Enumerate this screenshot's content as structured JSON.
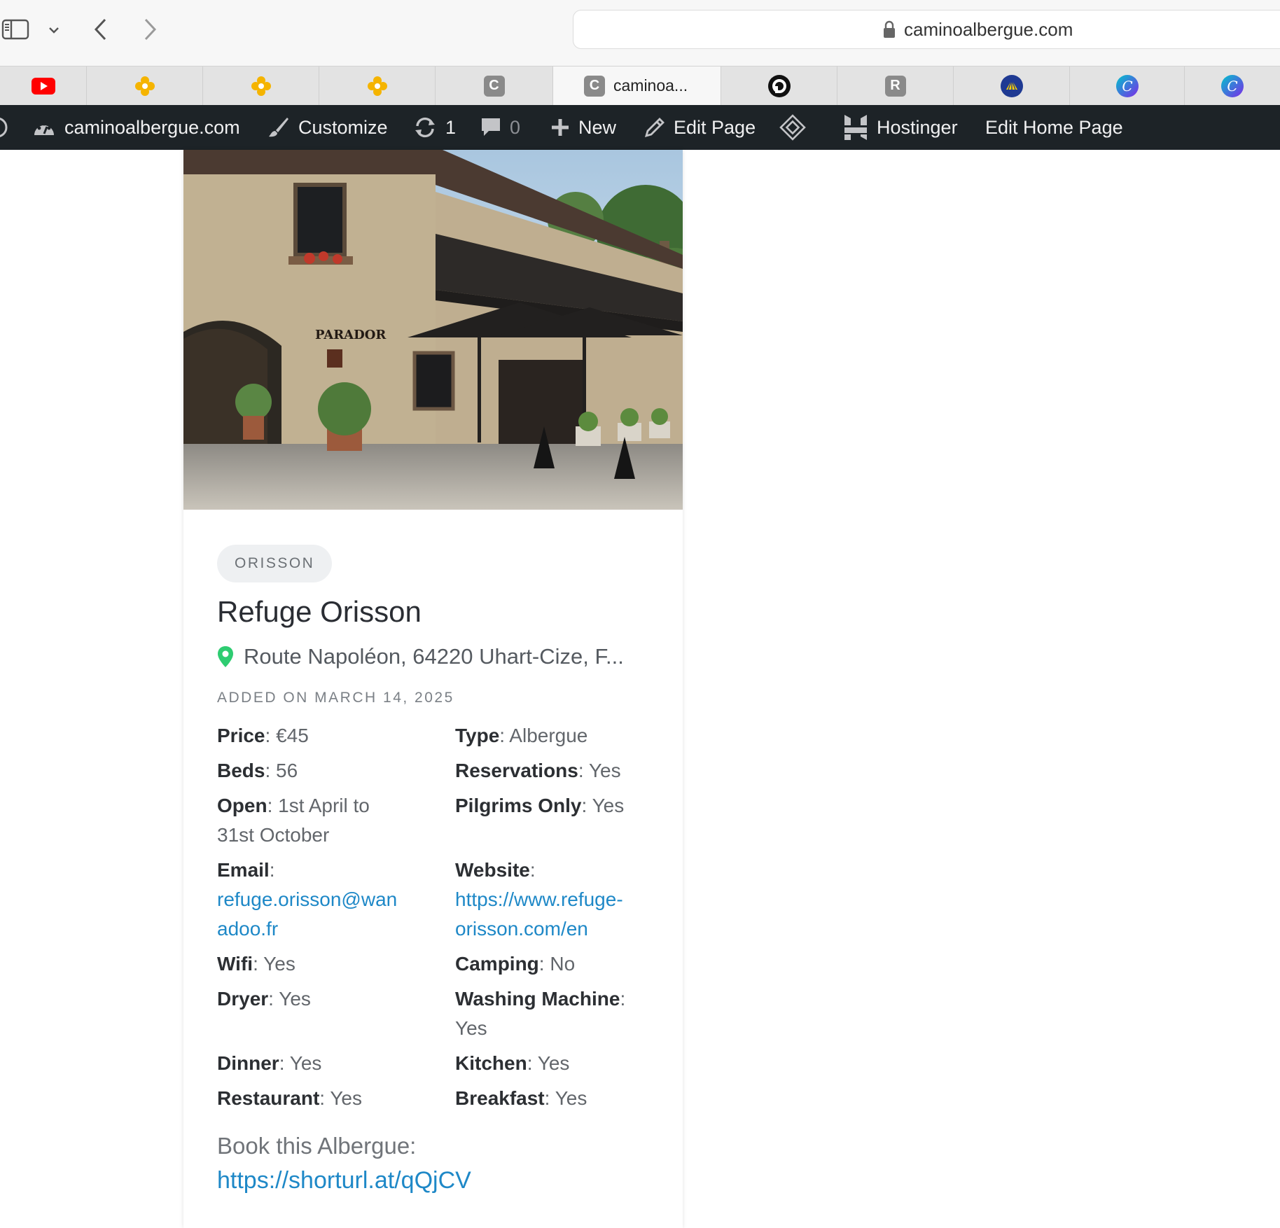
{
  "browser": {
    "url": "caminoalbergue.com",
    "tabs": [
      {
        "icon": "youtube-icon"
      },
      {
        "icon": "yellow-flower-icon"
      },
      {
        "icon": "yellow-flower-icon"
      },
      {
        "icon": "yellow-flower-icon"
      },
      {
        "icon": "c-icon",
        "letter": "C"
      },
      {
        "icon": "c-icon",
        "letter": "C",
        "title": "caminoa...",
        "active": true
      },
      {
        "icon": "circle-logo-icon"
      },
      {
        "icon": "r-icon",
        "letter": "R"
      },
      {
        "icon": "scallop-shell-icon"
      },
      {
        "icon": "canva-icon",
        "letter": "C"
      },
      {
        "icon": "canva-icon",
        "letter": "C"
      }
    ]
  },
  "adminbar": {
    "site": "caminoalbergue.com",
    "customize": "Customize",
    "updates_count": "1",
    "comments_count": "0",
    "new": "New",
    "edit_page": "Edit Page",
    "hostinger": "Hostinger",
    "edit_home": "Edit Home Page"
  },
  "listing": {
    "tag": "ORISSON",
    "title": "Refuge Orisson",
    "address": "Route Napoléon, 64220 Uhart-Cize, F...",
    "added": "ADDED ON MARCH 14, 2025",
    "photo_sign": "PARADOR",
    "fields": {
      "price_label": "Price",
      "price": "€45",
      "type_label": "Type",
      "type": "Albergue",
      "beds_label": "Beds",
      "beds": "56",
      "reservations_label": "Reservations",
      "reservations": "Yes",
      "open_label": "Open",
      "open_line1": "1st April to",
      "open_line2": "31st October",
      "pilgrims_label": "Pilgrims Only",
      "pilgrims": "Yes",
      "email_label": "Email",
      "email_line1": "refuge.orisson@wan",
      "email_line2": "adoo.fr",
      "website_label": "Website",
      "website_line1": "https://www.refuge-",
      "website_line2": "orisson.com/en",
      "wifi_label": "Wifi",
      "wifi": "Yes",
      "camping_label": "Camping",
      "camping": "No",
      "dryer_label": "Dryer",
      "dryer": "Yes",
      "washing_label": "Washing Machine",
      "washing": "Yes",
      "dinner_label": "Dinner",
      "dinner": "Yes",
      "kitchen_label": "Kitchen",
      "kitchen": "Yes",
      "restaurant_label": "Restaurant",
      "restaurant": "Yes",
      "breakfast_label": "Breakfast",
      "breakfast": "Yes"
    },
    "book_label": "Book this Albergue:",
    "book_link": "https://shorturl.at/qQjCV"
  },
  "colors": {
    "adminbar_bg": "#1d2327",
    "link": "#1e88c7",
    "pin": "#2ecc71"
  }
}
